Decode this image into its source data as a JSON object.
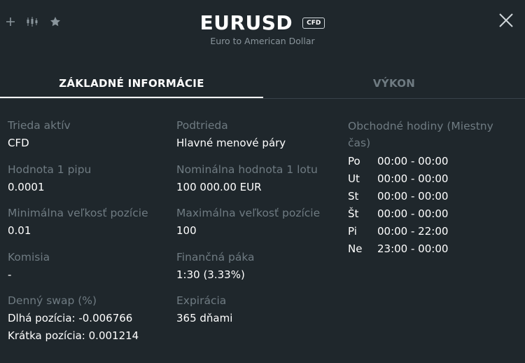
{
  "header": {
    "symbol": "EURUSD",
    "badge": "CFD",
    "subtitle": "Euro to American Dollar"
  },
  "tabs": [
    {
      "label": "ZÁKLADNÉ INFORMÁCIE",
      "active": true
    },
    {
      "label": "VÝKON",
      "active": false
    }
  ],
  "info": {
    "asset_class": {
      "label": "Trieda aktív",
      "value": "CFD"
    },
    "pip_value": {
      "label": "Hodnota 1 pipu",
      "value": "0.0001"
    },
    "min_size": {
      "label": "Minimálna veľkosť pozície",
      "value": "0.01"
    },
    "commission": {
      "label": "Komisia",
      "value": "-"
    },
    "swap": {
      "label": "Denný swap (%)",
      "long": "Dlhá pozícia: -0.006766",
      "short": "Krátka pozícia: 0.001214"
    },
    "subclass": {
      "label": "Podtrieda",
      "value": "Hlavné menové páry"
    },
    "lot_value": {
      "label": "Nominálna hodnota 1 lotu",
      "value": "100 000.00 EUR"
    },
    "max_size": {
      "label": "Maximálna veľkosť pozície",
      "value": "100"
    },
    "leverage": {
      "label": "Finančná páka",
      "value": "1:30 (3.33%)"
    },
    "expiration": {
      "label": "Expirácia",
      "value": "365 dňami"
    }
  },
  "trading_hours": {
    "label": "Obchodné hodiny (Miestny čas)",
    "days": [
      {
        "day": "Po",
        "hours": "00:00 - 00:00"
      },
      {
        "day": "Ut",
        "hours": "00:00 - 00:00"
      },
      {
        "day": "St",
        "hours": "00:00 - 00:00"
      },
      {
        "day": "Št",
        "hours": "00:00 - 00:00"
      },
      {
        "day": "Pi",
        "hours": "00:00 - 22:00"
      },
      {
        "day": "Ne",
        "hours": "23:00 - 00:00"
      }
    ]
  },
  "icons": {
    "add": "plus-icon",
    "chart": "candlestick-chart-icon",
    "favorite": "star-icon",
    "close": "close-icon"
  },
  "colors": {
    "background": "#1f272c",
    "muted_text": "#6f7b82",
    "text": "#ffffff"
  }
}
